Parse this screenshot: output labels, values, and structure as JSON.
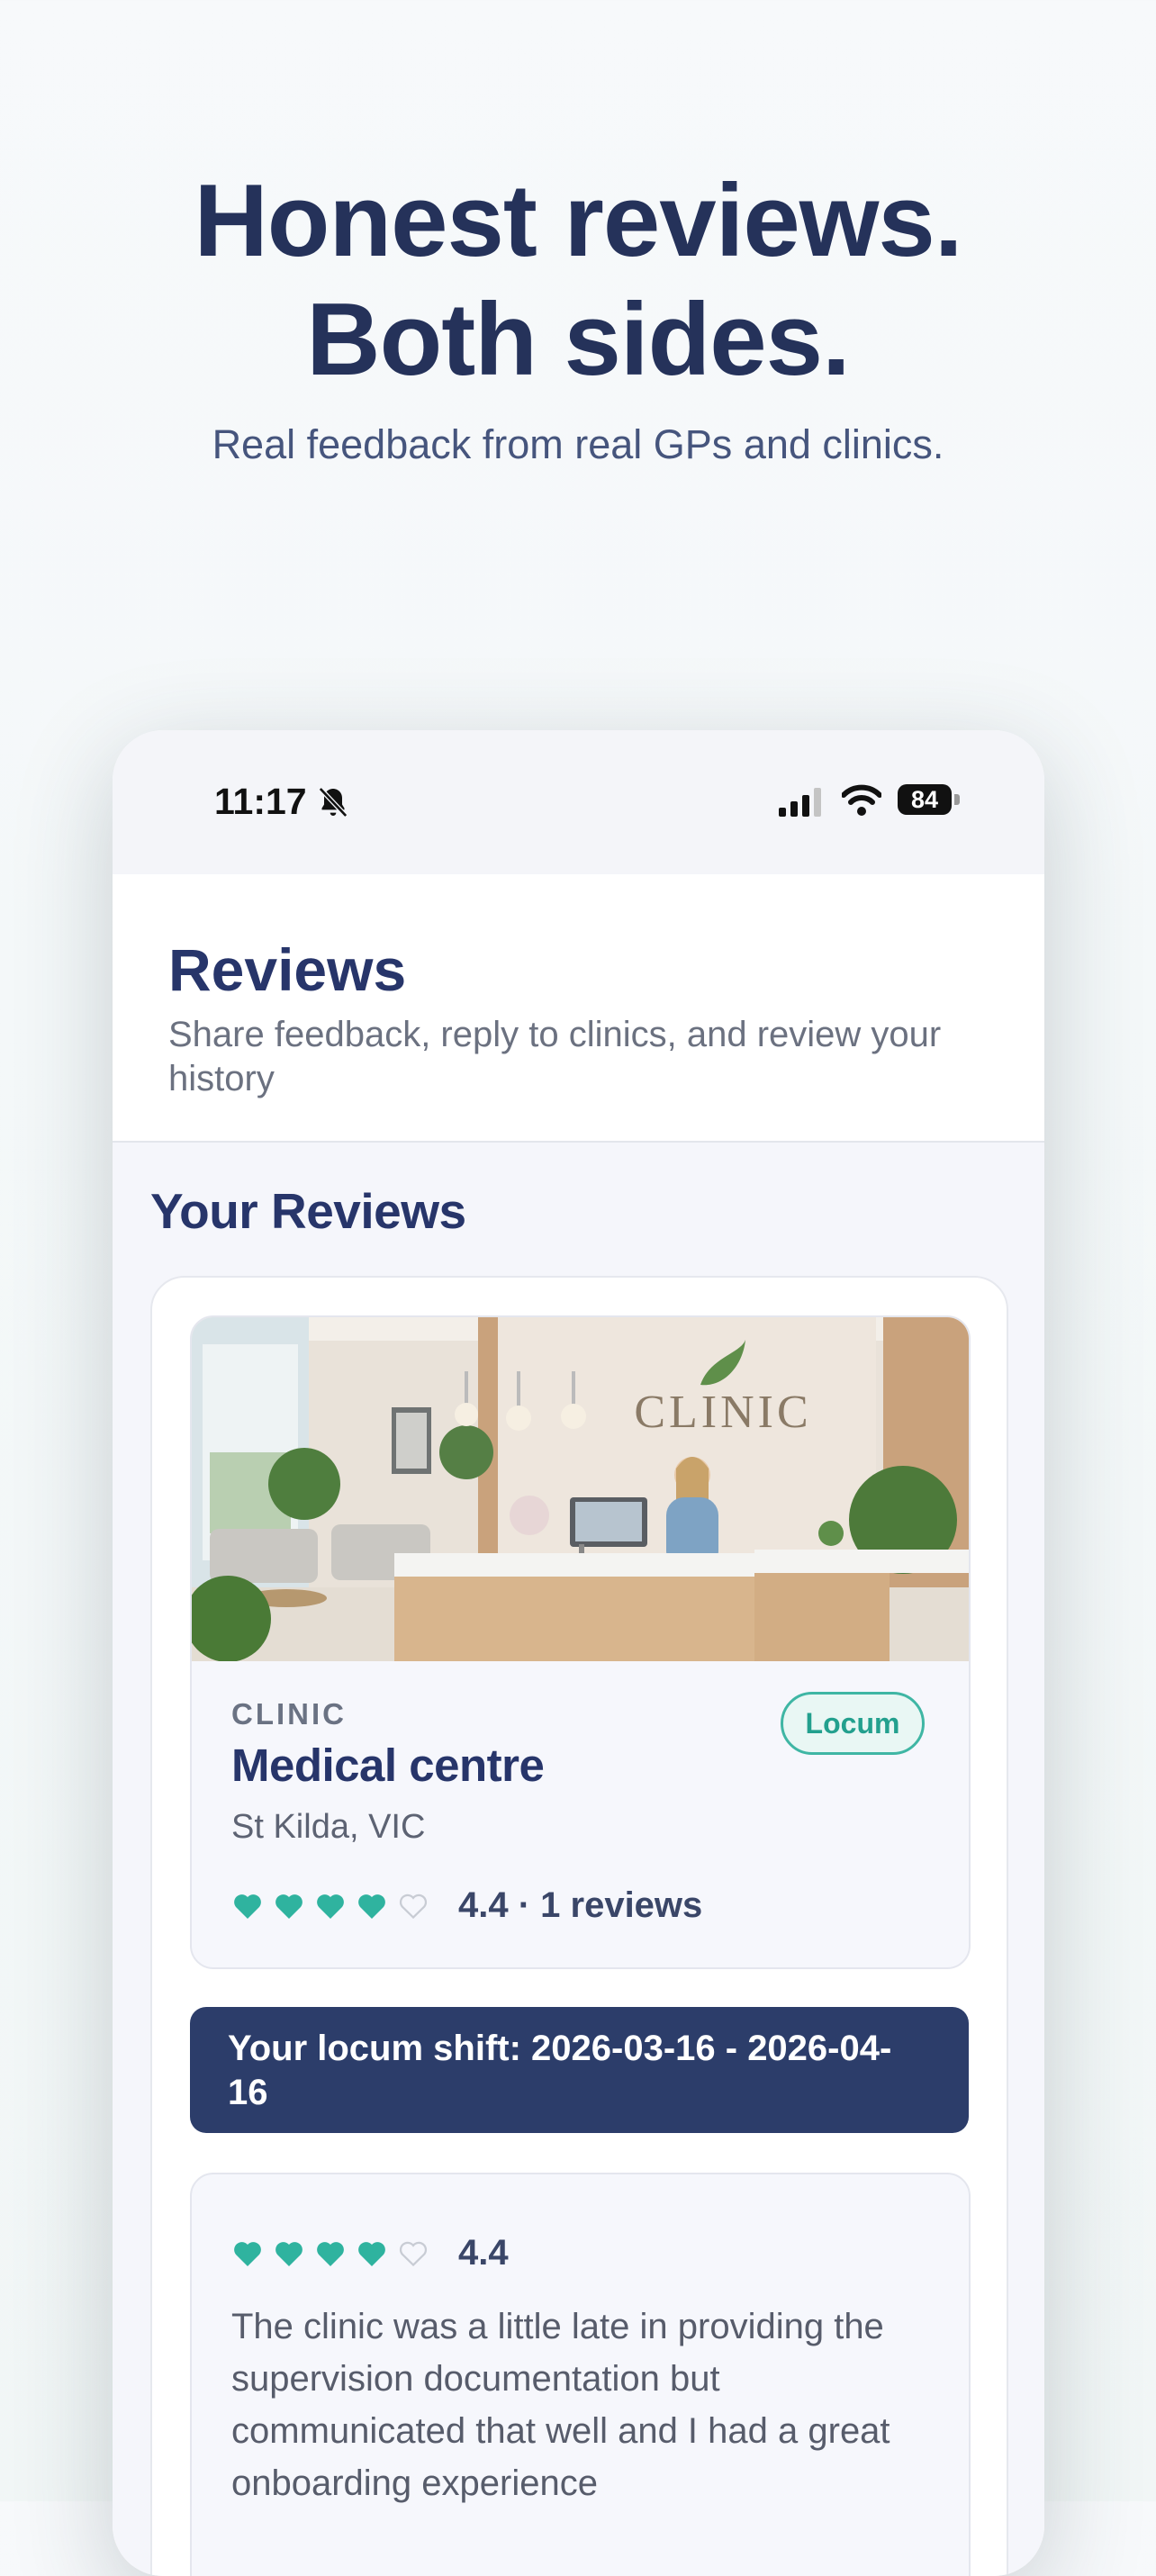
{
  "hero": {
    "title_line1": "Honest reviews.",
    "title_line2": "Both sides.",
    "subtitle": "Real feedback from real GPs and clinics."
  },
  "status_bar": {
    "time": "11:17",
    "battery": "84"
  },
  "header": {
    "title": "Reviews",
    "subtitle": "Share feedback, reply to clinics, and review your history"
  },
  "section": {
    "title": "Your Reviews"
  },
  "clinic": {
    "type": "CLINIC",
    "name": "Medical centre",
    "location": "St Kilda, VIC",
    "badge": "Locum",
    "rating_value": 4.4,
    "rating_text": "4.4 · 1 reviews",
    "image_sign": "CLINIC"
  },
  "shift": {
    "label": "Your locum shift: 2026-03-16 - 2026-04-16"
  },
  "review": {
    "rating_value": 4.4,
    "rating_text": "4.4",
    "text": "The clinic was a little late in providing the supervision documentation but communicated that well and I had a great onboarding experience"
  },
  "colors": {
    "primary_navy": "#27356a",
    "accent_teal": "#2fb39f",
    "banner_navy": "#2c3d6a"
  }
}
